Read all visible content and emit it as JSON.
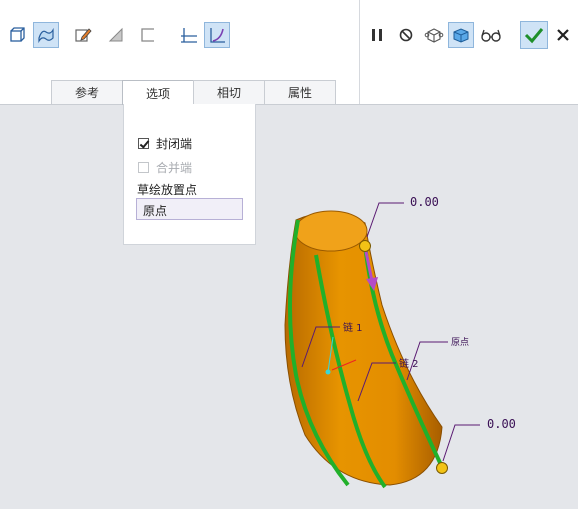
{
  "tabs": [
    {
      "label": "参考"
    },
    {
      "label": "选项"
    },
    {
      "label": "相切"
    },
    {
      "label": "属性"
    }
  ],
  "options_panel": {
    "closed_ends": {
      "label": "封闭端",
      "checked": true
    },
    "merge_ends": {
      "label": "合并端",
      "checked": false,
      "disabled": true
    },
    "sketch_placement_label": "草绘放置点",
    "sketch_placement_value": "原点"
  },
  "toolbar_icons": [
    "solid-icon",
    "surface-icon",
    "sketch-icon",
    "remove-material-icon",
    "thicken-icon",
    "constant-section-icon",
    "variable-section-icon",
    "pause-icon",
    "no-preview-icon",
    "verify-icon",
    "preview-icon",
    "glasses-icon",
    "ok-icon",
    "cancel-icon"
  ],
  "viewport": {
    "annotations": {
      "top_value": "0.00",
      "bottom_value": "0.00",
      "chain1": "链 1",
      "chain2": "链 2",
      "origin": "原点"
    },
    "colors": {
      "surface": "#e38d00",
      "chain": "#21b02a",
      "endpoint": "#f2c316",
      "arrow": "#b44cc6",
      "leader": "#5a1a72"
    }
  }
}
